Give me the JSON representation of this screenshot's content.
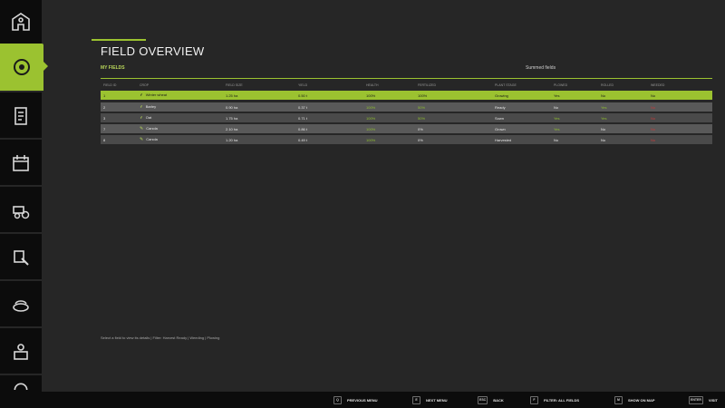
{
  "header": {
    "title": "FIELD OVERVIEW",
    "section": "MY FIELDS",
    "summary": "Summed fields"
  },
  "colors": {
    "accent": "#9bc230",
    "background": "#262626",
    "sidebar": "#0c0c0c",
    "row_odd": "#595959",
    "row_even": "#4a4a4a",
    "negative": "#c23b3b"
  },
  "sidebar": {
    "items": [
      {
        "icon": "farm-buildings-icon"
      },
      {
        "icon": "field-target-icon",
        "active": true
      },
      {
        "icon": "document-icon"
      },
      {
        "icon": "calendar-icon"
      },
      {
        "icon": "machinery-icon"
      },
      {
        "icon": "tools-icon"
      },
      {
        "icon": "animals-icon"
      },
      {
        "icon": "workers-icon"
      },
      {
        "icon": "help-icon"
      }
    ]
  },
  "table": {
    "columns": [
      "FIELD ID",
      "CROP",
      "FIELD SIZE",
      "YIELD",
      "HEALTH",
      "FERTILIZED",
      "PLANT STAGE",
      "PLOWED",
      "ROLLED",
      "WEEDED"
    ],
    "rows": [
      {
        "id": "1",
        "crop_icon": "wheat-icon",
        "crop": "Winter wheat",
        "size": "1.25 ha",
        "yield": "0.50 t",
        "health": "100%",
        "fertilized": "100%",
        "stage": "Growing",
        "plowed": "Yes",
        "rolled": "No",
        "weeded": "No"
      },
      {
        "id": "2",
        "crop_icon": "barley-icon",
        "crop": "Barley",
        "size": "0.90 ha",
        "yield": "0.37 t",
        "health": "100%",
        "fertilized": "50%",
        "stage": "Ready",
        "plowed": "No",
        "rolled": "Yes",
        "weeded": "No"
      },
      {
        "id": "3",
        "crop_icon": "oat-icon",
        "crop": "Oat",
        "size": "1.75 ha",
        "yield": "0.71 t",
        "health": "100%",
        "fertilized": "50%",
        "stage": "Sown",
        "plowed": "Yes",
        "rolled": "Yes",
        "weeded": "No"
      },
      {
        "id": "7",
        "crop_icon": "canola-icon",
        "crop": "Canola",
        "size": "2.10 ha",
        "yield": "0.86 t",
        "health": "100%",
        "fertilized": "0%",
        "stage": "Grown",
        "plowed": "Yes",
        "rolled": "No",
        "weeded": "No"
      },
      {
        "id": "8",
        "crop_icon": "canola-icon",
        "crop": "Canola",
        "size": "1.20 ha",
        "yield": "0.49 t",
        "health": "100%",
        "fertilized": "0%",
        "stage": "Harvested",
        "plowed": "No",
        "rolled": "No",
        "weeded": "No"
      }
    ]
  },
  "footnote": "Select a field to view its details  |  Filter: Harvest Ready | Weeding | Plowing",
  "bottom_bar": {
    "hints": [
      {
        "key": "Q",
        "label": "PREVIOUS MENU"
      },
      {
        "key": "E",
        "label": "NEXT MENU"
      },
      {
        "key": "ESC",
        "label": "BACK"
      },
      {
        "key": "F",
        "label": "FILTER: ALL FIELDS"
      },
      {
        "key": "M",
        "label": "SHOW ON MAP"
      },
      {
        "key": "ENTER",
        "label": "VISIT"
      }
    ]
  }
}
